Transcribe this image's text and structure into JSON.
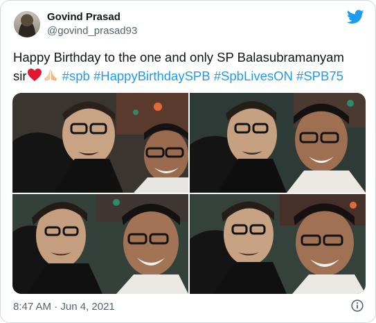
{
  "tweet": {
    "author": {
      "display_name": "Govind Prasad",
      "handle": "@govind_prasad93",
      "avatar": "avatar-photo"
    },
    "platform_icon": "twitter-bird-icon",
    "brand_color": "#1d9bf0",
    "text": {
      "line1": "Happy Birthday to the one and only SP Balasubramanyam",
      "sir": "sir",
      "emojis": [
        "red-heart",
        "folded-hands"
      ],
      "hashtags": [
        "#spb",
        "#HappyBirthdaySPB",
        "#SpbLivesON",
        "#SPB75"
      ]
    },
    "media": {
      "count": 4,
      "layout": "2x2 grid"
    },
    "timestamp": "8:47 AM · Jun 4, 2021",
    "info_icon": "info-icon"
  }
}
